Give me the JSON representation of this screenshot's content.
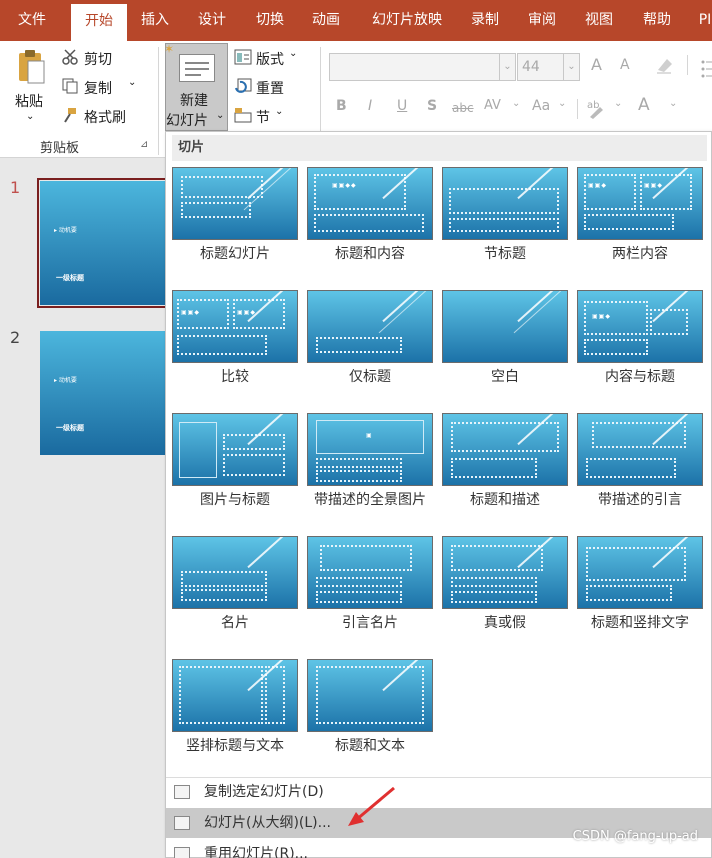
{
  "tabs": [
    "文件",
    "开始",
    "插入",
    "设计",
    "切换",
    "动画",
    "幻灯片放映",
    "录制",
    "审阅",
    "视图",
    "帮助",
    "PI"
  ],
  "ribbon": {
    "paste": "粘贴",
    "cut": "剪切",
    "copy": "复制",
    "format_painter": "格式刷",
    "clipboard_group": "剪贴板",
    "new_slide_line1": "新建",
    "new_slide_line2": "幻灯片",
    "layout": "版式",
    "reset": "重置",
    "section": "节",
    "font_size": "44",
    "bold": "B",
    "italic": "I",
    "underline": "U",
    "shadow": "S",
    "strike": "abc",
    "spacing": "AV",
    "case": "Aa",
    "grow": "A",
    "shrink": "A",
    "font_color": "A"
  },
  "slides": {
    "items": [
      {
        "number": "1",
        "subtitle": "动机要",
        "title": "一级标题"
      },
      {
        "number": "2",
        "subtitle": "动机要",
        "title": "一级标题"
      }
    ]
  },
  "gallery": {
    "header": "切片",
    "layouts": [
      "标题幻灯片",
      "标题和内容",
      "节标题",
      "两栏内容",
      "比较",
      "仅标题",
      "空白",
      "内容与标题",
      "图片与标题",
      "带描述的全景图片",
      "标题和描述",
      "带描述的引言",
      "名片",
      "引言名片",
      "真或假",
      "标题和竖排文字",
      "竖排标题与文本",
      "标题和文本"
    ],
    "menu": [
      "复制选定幻灯片(D)",
      "幻灯片(从大纲)(L)...",
      "重用幻灯片(R)..."
    ]
  },
  "watermark": "CSDN @fang-up-ad"
}
